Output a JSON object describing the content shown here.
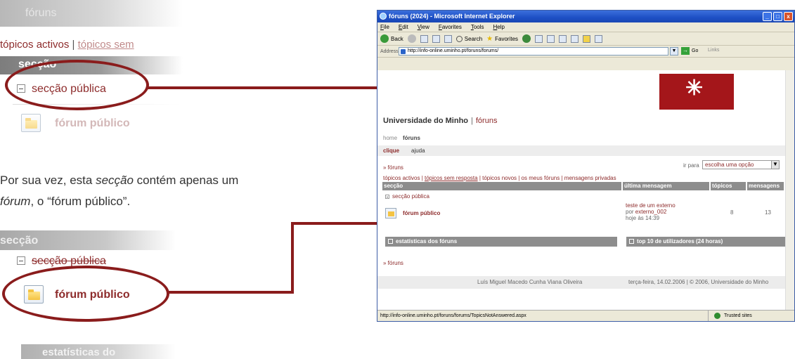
{
  "zoom_top": {
    "faded_title": "fóruns",
    "links": {
      "active": "tópicos activos",
      "sep": " | ",
      "unanswered": "tópicos sem"
    },
    "section_header": "secção",
    "section_row": "secção pública",
    "forum_label": "fórum público"
  },
  "caption": {
    "p1_prefix": "Por sua vez, esta ",
    "p1_em": "secção",
    "p1_suffix": " contém apenas um",
    "p2_em": "fórum",
    "p2_suffix": ", o “fórum público”."
  },
  "zoom_bottom": {
    "section_header": "secção",
    "section_row": "secção pública",
    "forum_label": "fórum público",
    "stats_label": "estatísticas do"
  },
  "browser": {
    "title": "fóruns (2024) - Microsoft Internet Explorer",
    "menu": [
      "File",
      "Edit",
      "View",
      "Favorites",
      "Tools",
      "Help"
    ],
    "toolbar": {
      "back": "Back",
      "search": "Search",
      "favorites": "Favorites"
    },
    "address_label": "Address",
    "address_value": "http://info-online.uminho.pt/foruns/forums/",
    "go_label": "Go",
    "links_label": "Links",
    "status_url": "http://info-online.uminho.pt/foruns/forums/TopicsNotAnswered.aspx",
    "status_zone": "Trusted sites"
  },
  "page": {
    "university": "Universidade do Minho",
    "site_sep": "|",
    "site_name": "fóruns",
    "nav_home": "home",
    "nav_foruns": "fóruns",
    "action_clique": "clique",
    "action_ajuda": "ajuda",
    "breadcrumb": "» fóruns",
    "ir_para": "ir para",
    "select_value": "escolha uma opção",
    "top_links": {
      "active": "tópicos activos",
      "sep1": " | ",
      "unanswered": "tópicos sem resposta",
      "rest": " | tópicos novos | os meus fóruns | mensagens privadas"
    },
    "table_headers": [
      "secção",
      "última mensagem",
      "tópicos",
      "mensagens"
    ],
    "section_row": "secção pública",
    "forum": {
      "name": "fórum público",
      "last_post_title": "teste de um externo",
      "last_post_by_prefix": "por ",
      "last_post_by": "externo_002",
      "last_post_time": "hoje às 14:39",
      "topics": "8",
      "messages": "13"
    },
    "stats_label": "estatísticas dos fóruns",
    "top10_label": "top 10 de utilizadores (24 horas)",
    "breadcrumb_bottom": "» fóruns",
    "footer_left": "Luís Miguel Macedo Cunha Viana Oliveira",
    "footer_right": "terça-feira, 14.02.2006 | © 2006, Universidade do Minho"
  },
  "colors": {
    "accent": "#8a1c1c",
    "link": "#8d2b2b",
    "logo": "#a4161a"
  }
}
